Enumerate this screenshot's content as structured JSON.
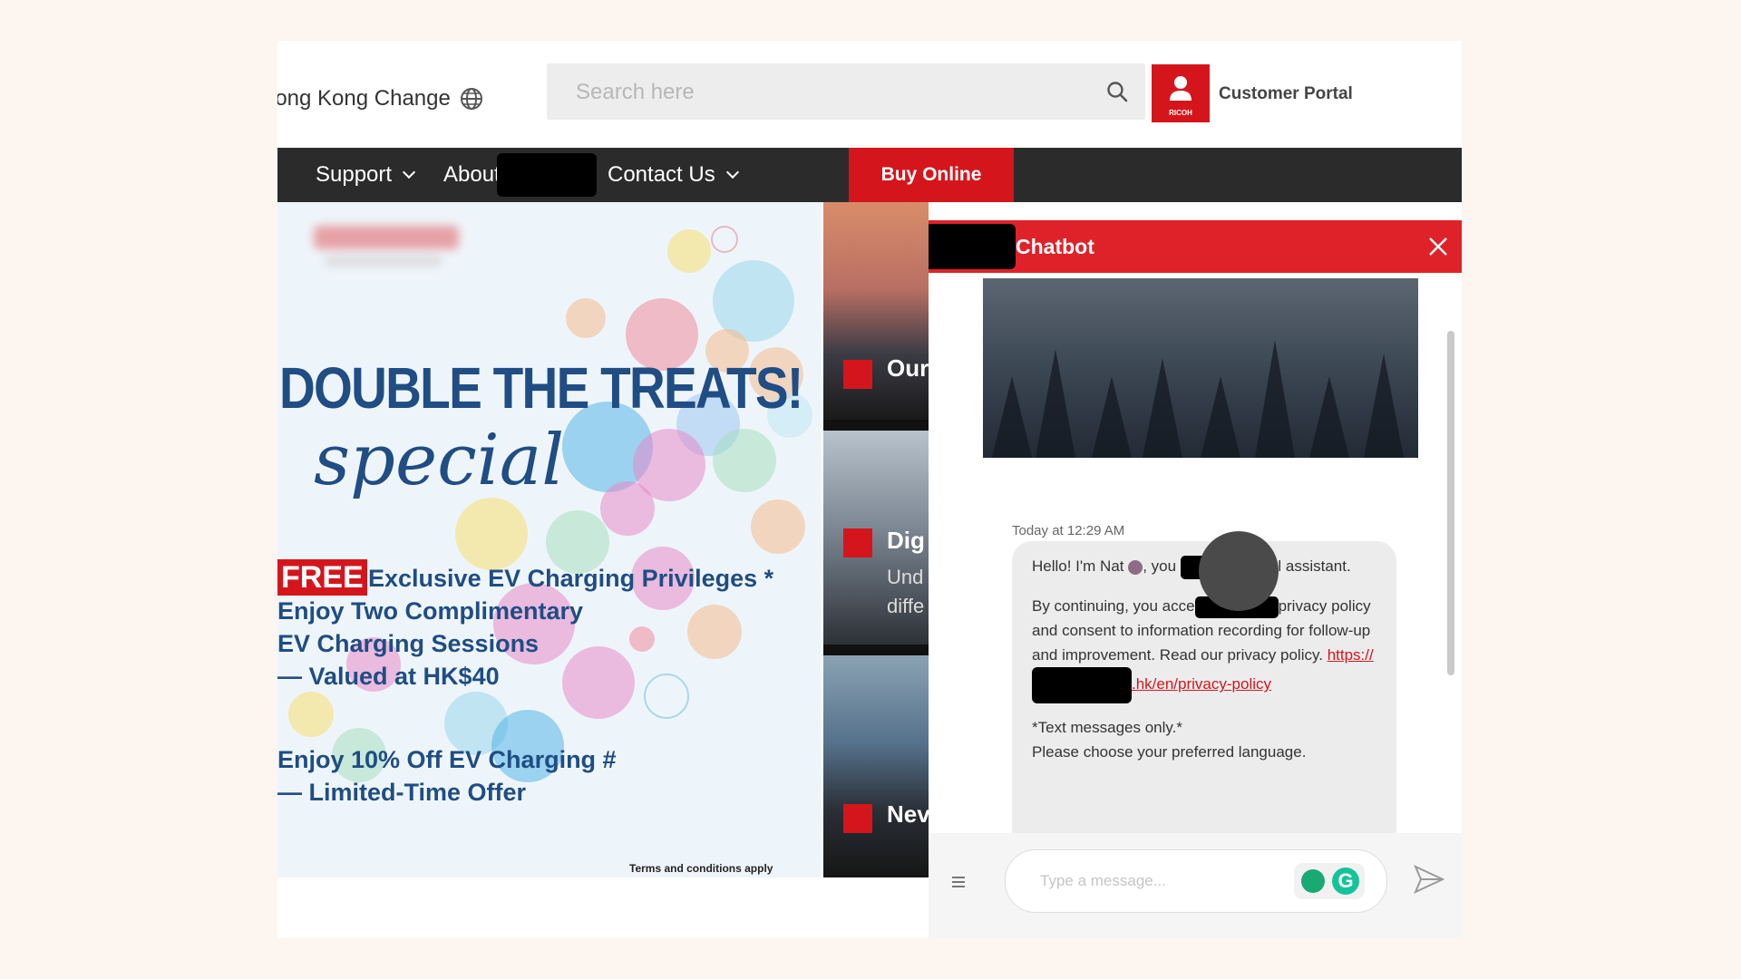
{
  "header": {
    "region_label": "long Kong Change",
    "search_placeholder": "Search here",
    "portal_logo_text": "RICOH",
    "portal_label": "Customer Portal"
  },
  "nav": {
    "items": [
      {
        "label": "Support"
      },
      {
        "label": "About"
      },
      {
        "label": "Contact Us"
      }
    ],
    "buy_label": "Buy Online"
  },
  "banner": {
    "headline": "DOUBLE THE TREATS!",
    "special": "special",
    "free_badge": "FREE",
    "promo1": "Exclusive EV Charging Privileges *",
    "promo1_lines": [
      "Enjoy Two Complimentary",
      "EV Charging Sessions",
      "— Valued at HK$40"
    ],
    "promo2_lines": [
      "Enjoy 10% Off EV Charging #",
      "— Limited-Time Offer"
    ],
    "terms": "Terms and conditions apply"
  },
  "cards": [
    {
      "title": "Our"
    },
    {
      "title": "Dig",
      "sub": [
        "Und",
        "diffe"
      ]
    },
    {
      "title": "Nev"
    }
  ],
  "chatbot": {
    "title": "Chatbot",
    "timestamp": "Today at 12:29 AM",
    "greeting_pre": "Hello! I'm Nat",
    "greeting_mid": ", you",
    "greeting_post": "virtual assistant.",
    "consent_pre": "By continuing, you acce",
    "consent_post": "privacy policy and consent to information recording for follow-up and improvement. Read our privacy policy.",
    "link_text": "https://",
    "link_tail": ".hk/en/privacy-policy",
    "note": "*Text messages only.*",
    "choose": "Please choose your preferred language.",
    "input_placeholder": "Type a message..."
  },
  "colors": {
    "brand_red": "#d4161c",
    "nav_bg": "#2b2b2b",
    "headline_blue": "#1f4d84"
  }
}
